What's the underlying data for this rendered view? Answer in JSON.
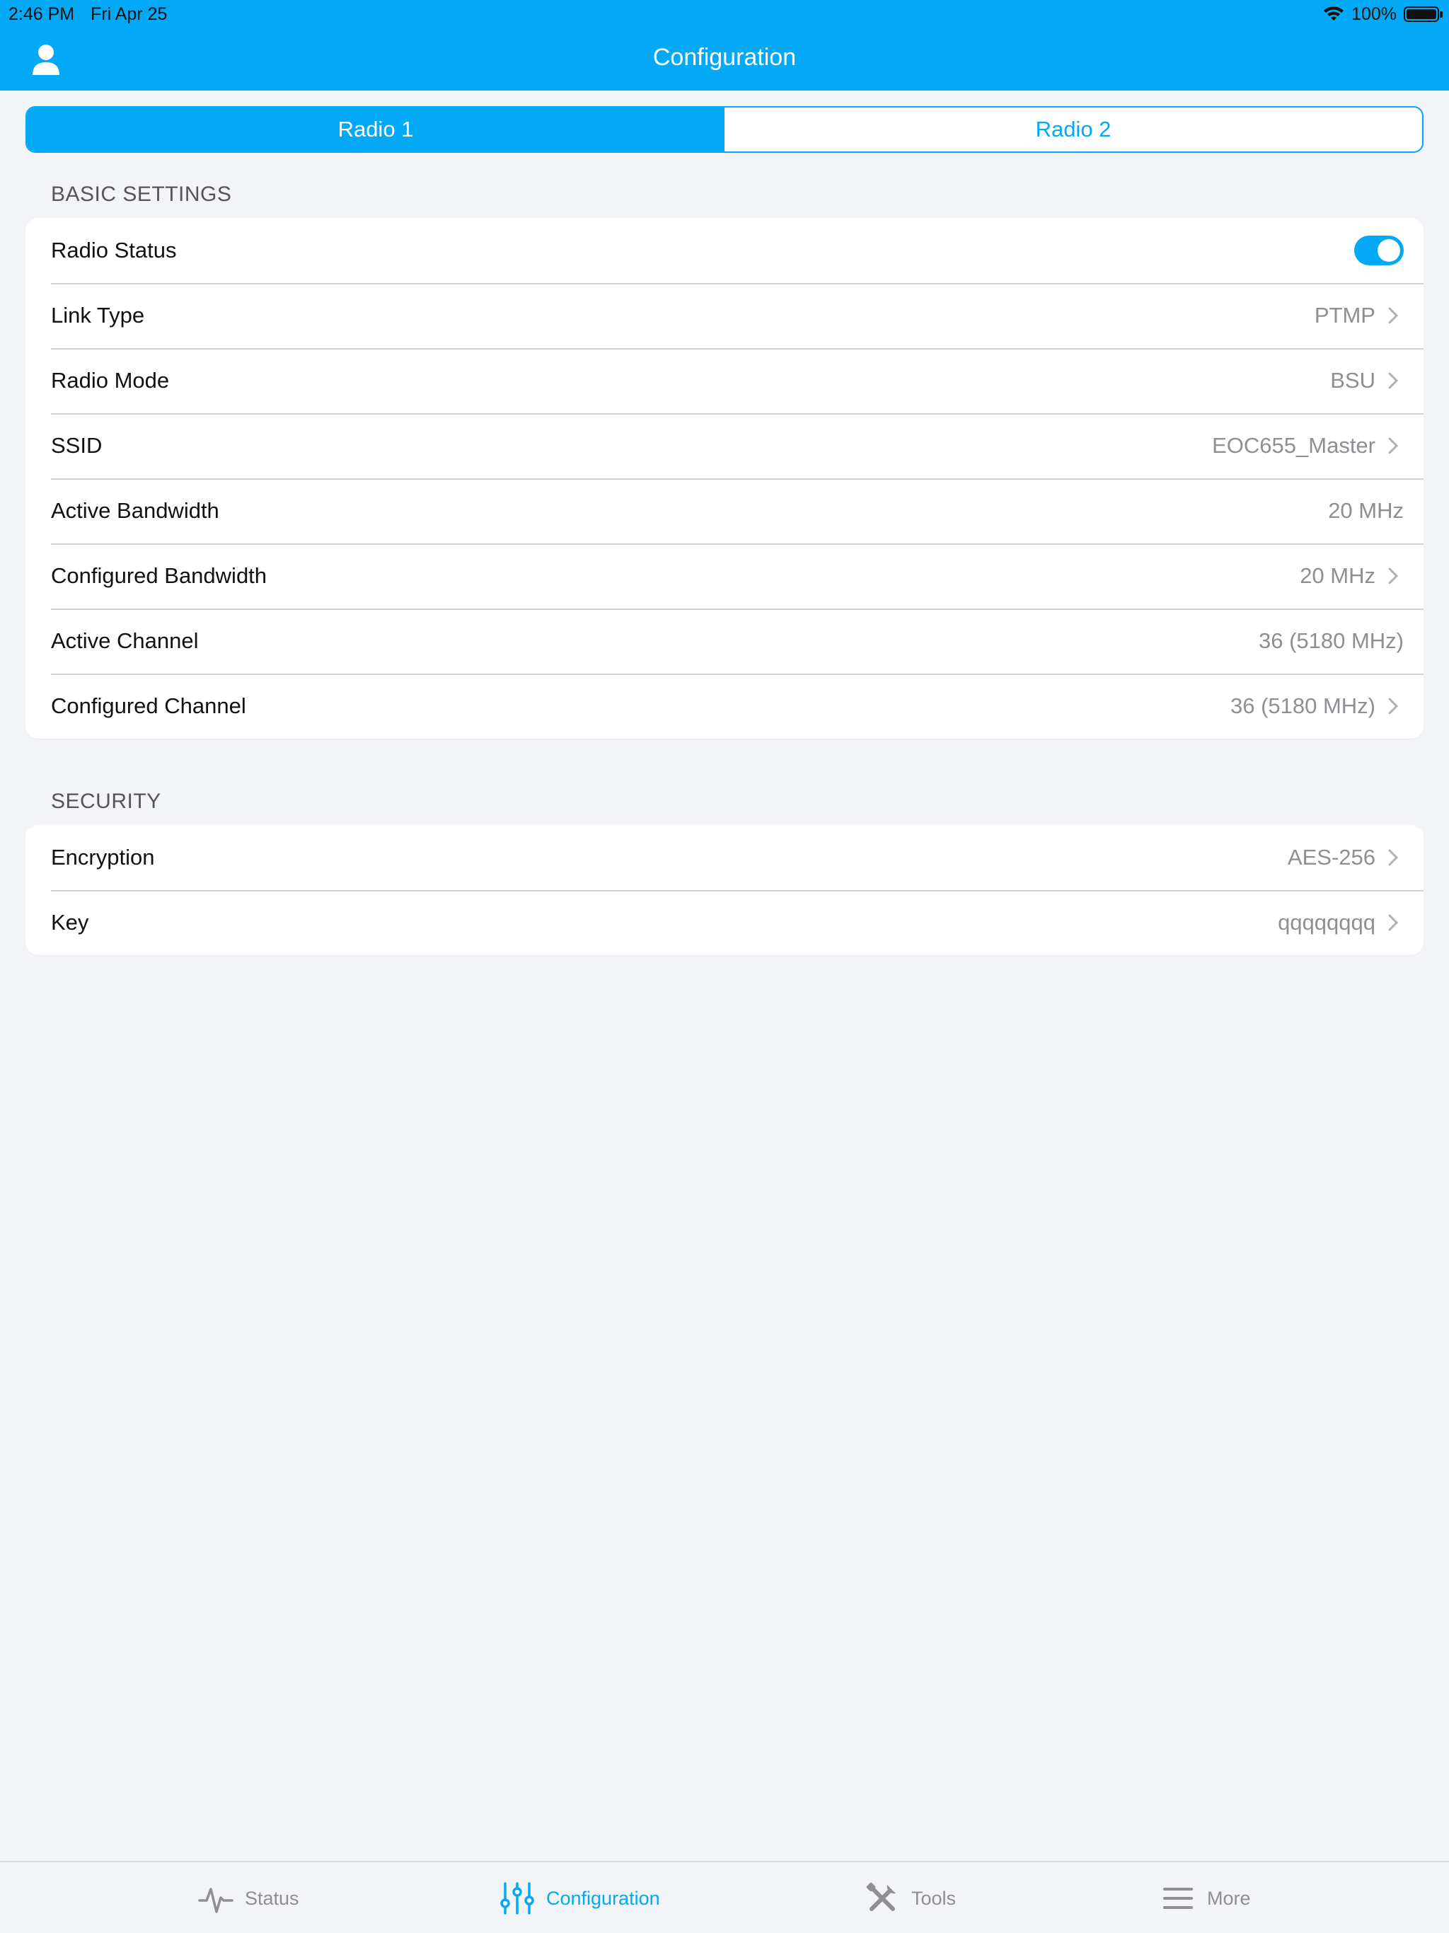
{
  "status_bar": {
    "time": "2:46 PM",
    "date": "Fri Apr 25",
    "battery": "100%"
  },
  "header": {
    "title": "Configuration",
    "user_icon": "person-icon",
    "color": "#03a9f4"
  },
  "segments": [
    {
      "label": "Radio 1",
      "selected": true
    },
    {
      "label": "Radio 2",
      "selected": false
    }
  ],
  "sections": {
    "basic": {
      "header": "BASIC SETTINGS",
      "rows": [
        {
          "label": "Radio Status",
          "value": "",
          "toggle": true
        },
        {
          "label": "Link Type",
          "value": "PTMP",
          "chevron": true
        },
        {
          "label": "Radio Mode",
          "value": "BSU",
          "chevron": true
        },
        {
          "label": "SSID",
          "value": "EOC655_Master",
          "chevron": true
        },
        {
          "label": "Active Bandwidth",
          "value": "20 MHz",
          "chevron": false
        },
        {
          "label": "Configured Bandwidth",
          "value": "20 MHz",
          "chevron": true
        },
        {
          "label": "Active Channel",
          "value": "36 (5180 MHz)",
          "chevron": false
        },
        {
          "label": "Configured Channel",
          "value": "36 (5180 MHz)",
          "chevron": true
        }
      ]
    },
    "security": {
      "header": "SECURITY",
      "rows": [
        {
          "label": "Encryption",
          "value": "AES-256",
          "chevron": true
        },
        {
          "label": "Key",
          "value": "qqqqqqqq",
          "chevron": true
        }
      ]
    }
  },
  "tabbar": [
    {
      "label": "Status",
      "icon": "pulse-icon",
      "active": false
    },
    {
      "label": "Configuration",
      "icon": "sliders-icon",
      "active": true
    },
    {
      "label": "Tools",
      "icon": "tools-icon",
      "active": false
    },
    {
      "label": "More",
      "icon": "menu-icon",
      "active": false
    }
  ]
}
